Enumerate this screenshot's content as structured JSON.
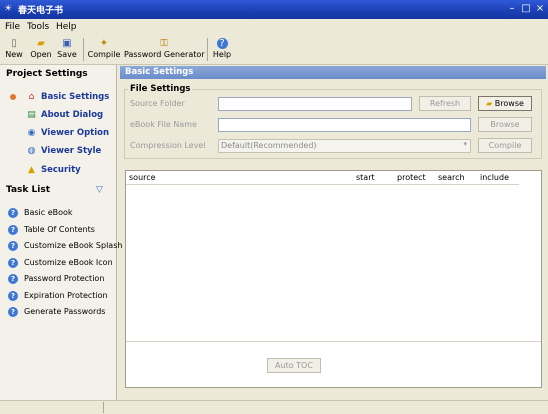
{
  "window": {
    "title": "春天电子书",
    "controls": [
      "–",
      "□",
      "×"
    ]
  },
  "menu": [
    "File",
    "Tools",
    "Help"
  ],
  "toolbar": [
    {
      "label": "New",
      "icon": "new-file-icon"
    },
    {
      "label": "Open",
      "icon": "open-folder-icon"
    },
    {
      "label": "Save",
      "icon": "save-icon"
    },
    {
      "label": "Compile",
      "icon": "compile-icon"
    },
    {
      "label": "Password Generator",
      "icon": "key-icon"
    },
    {
      "label": "Help",
      "icon": "help-icon"
    }
  ],
  "project_settings": {
    "title": "Project Settings",
    "items": [
      {
        "label": "Basic Settings",
        "icon": "home-icon"
      },
      {
        "label": "About Dialog",
        "icon": "dialog-icon"
      },
      {
        "label": "Viewer Option",
        "icon": "viewer-option-icon"
      },
      {
        "label": "Viewer Style",
        "icon": "viewer-style-icon"
      },
      {
        "label": "Security",
        "icon": "lock-icon"
      }
    ]
  },
  "task_list": {
    "title": "Task List",
    "items": [
      "Basic eBook",
      "Table Of Contents",
      "Customize eBook Splash",
      "Customize eBook Icon",
      "Password Protection",
      "Expiration Protection",
      "Generate Passwords"
    ]
  },
  "basic_settings": {
    "header": "Basic Settings",
    "group_title": "File Settings",
    "source_folder_label": "Source Folder",
    "ebook_file_name_label": "eBook File Name",
    "compression_level_label": "Compression Level",
    "compression_value": "Default(Recommended)",
    "refresh_label": "Refresh",
    "browse_label": "Browse",
    "browse2_label": "Browse",
    "compile_label": "Compile",
    "table_columns": [
      "source",
      "start",
      "protect",
      "search",
      "include"
    ],
    "auto_toc_label": "Auto TOC"
  }
}
